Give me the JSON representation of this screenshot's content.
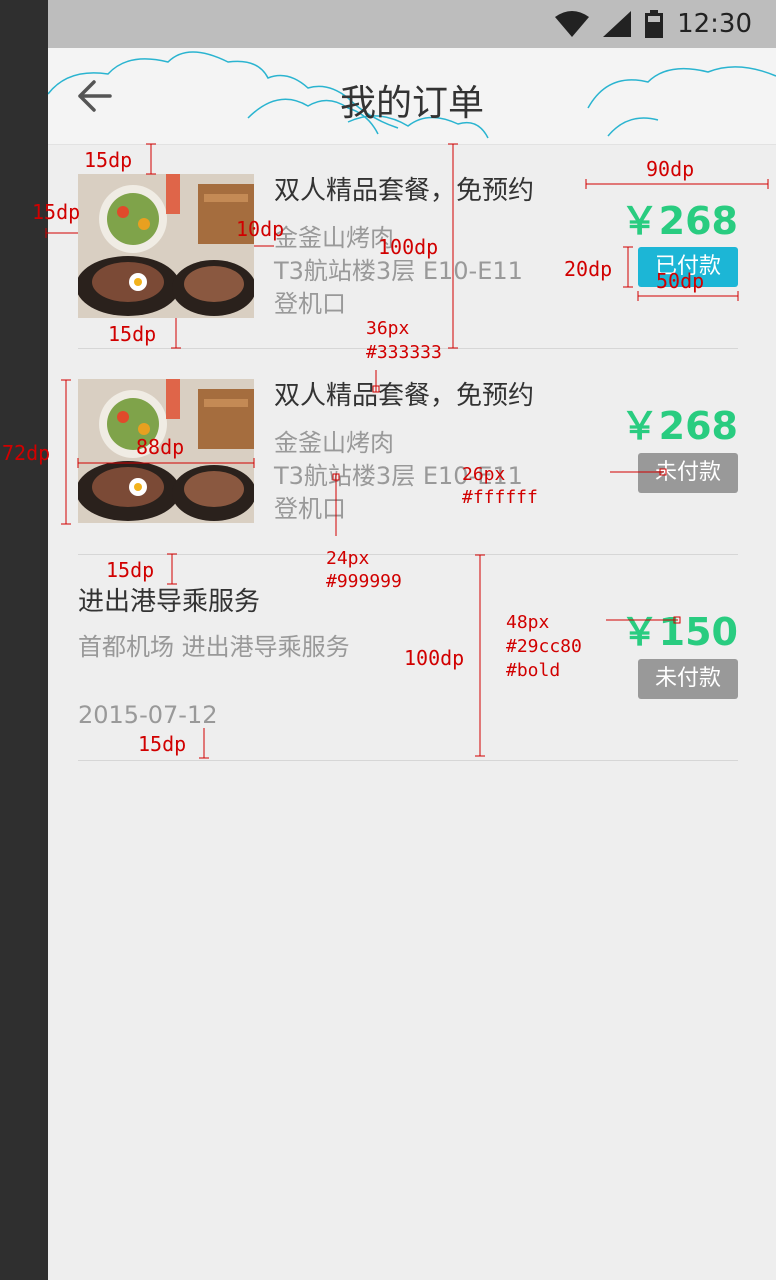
{
  "status": {
    "time": "12:30"
  },
  "header": {
    "title": "我的订单"
  },
  "orders": [
    {
      "title": "双人精品套餐，免预约",
      "subtitle_lines": [
        "金釜山烤肉",
        "T3航站楼3层  E10-E11",
        "登机口"
      ],
      "price": "￥268",
      "status": "已付款",
      "status_color": "#1cb6d6"
    },
    {
      "title": "双人精品套餐，免预约",
      "subtitle_lines": [
        "金釜山烤肉",
        "T3航站楼3层  E10-E11",
        "登机口"
      ],
      "price": "￥268",
      "status": "未付款",
      "status_color": "#999999"
    },
    {
      "title": "进出港导乘服务",
      "subtitle": "首都机场  进出港导乘服务",
      "date": "2015-07-12",
      "price": "￥150",
      "status": "未付款",
      "status_color": "#999999"
    }
  ],
  "annotations": {
    "15dp_a": "15dp",
    "15dp_b": "15dp",
    "10dp": "10dp",
    "100dp_a": "100dp",
    "90dp": "90dp",
    "20dp": "20dp",
    "50dp": "50dp",
    "15dp_c": "15dp",
    "36px": "36px",
    "color_333": "#333333",
    "72dp": "72dp",
    "88dp": "88dp",
    "26px": "26px",
    "color_fff": "#ffffff",
    "24px": "24px",
    "color_999": "#999999",
    "15dp_d": "15dp",
    "100dp_b": "100dp",
    "48px": "48px",
    "color_green": "#29cc80",
    "bold": "#bold",
    "15dp_e": "15dp"
  },
  "colors": {
    "accent": "#29cc80",
    "paid": "#1cb6d6",
    "unpaid": "#999999",
    "titlebar": "#f4f4f4"
  }
}
